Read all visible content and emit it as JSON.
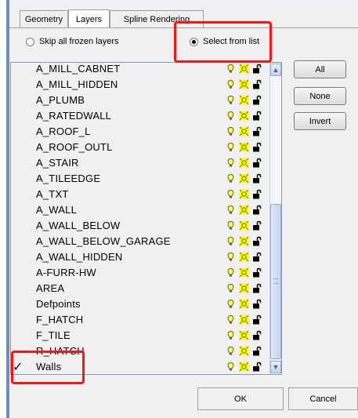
{
  "tabs": [
    {
      "label": "Geometry"
    },
    {
      "label": "Layers"
    },
    {
      "label": "Spline Rendering"
    }
  ],
  "radios": {
    "skip_label": "Skip all frozen layers",
    "select_label": "Select from list"
  },
  "layers": [
    {
      "name": "A_MILL_CABNET"
    },
    {
      "name": "A_MILL_HIDDEN"
    },
    {
      "name": "A_PLUMB"
    },
    {
      "name": "A_RATEDWALL"
    },
    {
      "name": "A_ROOF_L"
    },
    {
      "name": "A_ROOF_OUTL"
    },
    {
      "name": "A_STAIR"
    },
    {
      "name": "A_TILEEDGE"
    },
    {
      "name": "A_TXT"
    },
    {
      "name": "A_WALL"
    },
    {
      "name": "A_WALL_BELOW"
    },
    {
      "name": "A_WALL_BELOW_GARAGE"
    },
    {
      "name": "A_WALL_HIDDEN"
    },
    {
      "name": "A-FURR-HW"
    },
    {
      "name": "AREA"
    },
    {
      "name": "Defpoints"
    },
    {
      "name": "F_HATCH"
    },
    {
      "name": "F_TILE"
    },
    {
      "name": "R_HATCH"
    },
    {
      "name": "Walls",
      "check": "✓"
    }
  ],
  "side_buttons": {
    "all": "All",
    "none": "None",
    "invert": "Invert"
  },
  "footer": {
    "ok": "OK",
    "cancel": "Cancel"
  },
  "colors": {
    "highlight_box": "#ff1414",
    "bulb": "#ffff66",
    "sun": "#ffff00"
  }
}
